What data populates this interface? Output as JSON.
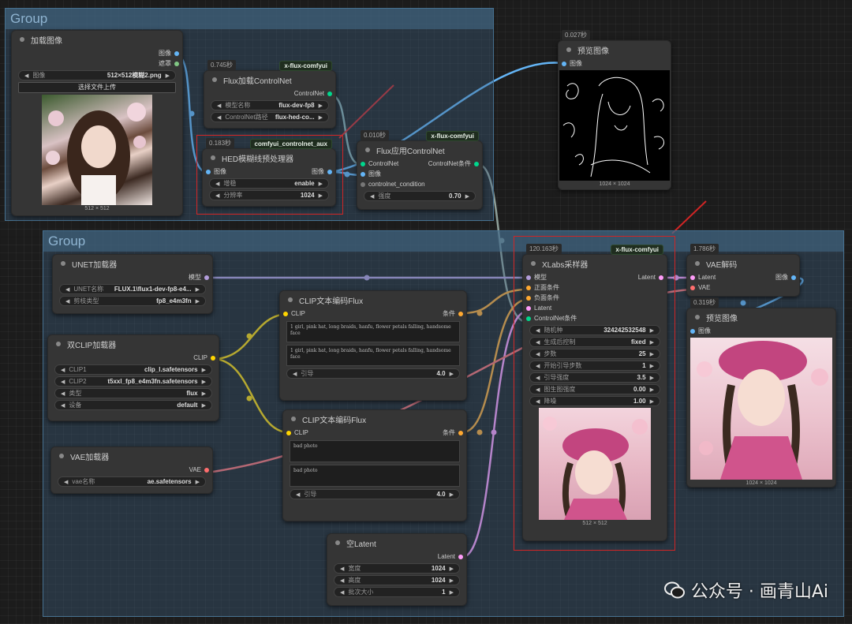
{
  "groups": [
    {
      "title": "Group"
    },
    {
      "title": "Group"
    }
  ],
  "nodes": {
    "load_image": {
      "title": "加载图像",
      "outputs": [
        "图像",
        "遮罩"
      ],
      "image_label": "图像",
      "image_value": "512×512模糊2.png",
      "upload_button": "选择文件上传",
      "caption": "512 × 512"
    },
    "flux_load_cn": {
      "timer": "0.745秒",
      "badge": "x-flux-comfyui",
      "title": "Flux加载ControlNet",
      "output": "ControlNet",
      "model_label": "模型名称",
      "model_value": "flux-dev-fp8",
      "path_label": "ControlNet路径",
      "path_value": "flux-hed-co..."
    },
    "hed": {
      "timer": "0.183秒",
      "badge": "comfyui_controlnet_aux",
      "title": "HED模糊线预处理器",
      "input": "图像",
      "output": "图像",
      "w1_label": "增稳",
      "w1_value": "enable",
      "w2_label": "分辨率",
      "w2_value": "1024"
    },
    "flux_apply_cn": {
      "timer": "0.010秒",
      "badge": "x-flux-comfyui",
      "title": "Flux应用ControlNet",
      "in1": "ControlNet",
      "in2": "图像",
      "in3": "controlnet_condition",
      "output": "ControlNet条件",
      "w_label": "强度",
      "w_value": "0.70"
    },
    "preview1": {
      "timer": "0.027秒",
      "title": "预览图像",
      "input": "图像",
      "caption": "1024 × 1024"
    },
    "unet": {
      "title": "UNET加载器",
      "output": "模型",
      "w1_label": "UNET名称",
      "w1_value": "FLUX.1\\flux1-dev-fp8-e4...",
      "w2_label": "剪枝类型",
      "w2_value": "fp8_e4m3fn"
    },
    "dualclip": {
      "title": "双CLIP加载器",
      "output": "CLIP",
      "w1_label": "CLIP1",
      "w1_value": "clip_l.safetensors",
      "w2_label": "CLIP2",
      "w2_value": "t5xxl_fp8_e4m3fn.safetensors",
      "w3_label": "类型",
      "w3_value": "flux",
      "w4_label": "设备",
      "w4_value": "default"
    },
    "vae_loader": {
      "title": "VAE加载器",
      "output": "VAE",
      "w_label": "vae名称",
      "w_value": "ae.safetensors"
    },
    "clip_pos": {
      "title": "CLIP文本编码Flux",
      "input": "CLIP",
      "output": "条件",
      "text1": "1 girl, pink hat, long braids, hanfu, flower petals falling, handsome face",
      "text2": "1 girl, pink hat, long braids, hanfu, flower petals falling, handsome face",
      "w_label": "引导",
      "w_value": "4.0"
    },
    "clip_neg": {
      "title": "CLIP文本编码Flux",
      "input": "CLIP",
      "output": "条件",
      "text1": "bad photo",
      "text2": "bad photo",
      "w_label": "引导",
      "w_value": "4.0"
    },
    "empty_latent": {
      "title": "空Latent",
      "output": "Latent",
      "w1_label": "宽度",
      "w1_value": "1024",
      "w2_label": "高度",
      "w2_value": "1024",
      "w3_label": "批次大小",
      "w3_value": "1"
    },
    "sampler": {
      "timer": "120.163秒",
      "badge": "x-flux-comfyui",
      "title": "XLabs采样器",
      "in1": "模型",
      "in2": "正面条件",
      "in3": "负面条件",
      "in4": "Latent",
      "in5": "ControlNet条件",
      "output": "Latent",
      "seed_label": "随机种",
      "seed_value": "324242532548",
      "ctrl_label": "生成后控制",
      "ctrl_value": "fixed",
      "steps_label": "步数",
      "steps_value": "25",
      "start_label": "开始引导步数",
      "start_value": "1",
      "guid_label": "引导强度",
      "guid_value": "3.5",
      "i2i_label": "图生图强度",
      "i2i_value": "0.00",
      "denoise_label": "降噪",
      "denoise_value": "1.00",
      "caption": "512 × 512"
    },
    "vae_decode": {
      "timer": "1.786秒",
      "title": "VAE解码",
      "in1": "Latent",
      "in2": "VAE",
      "output": "图像"
    },
    "preview2": {
      "timer": "0.319秒",
      "title": "预览图像",
      "input": "图像",
      "caption": "1024 × 1024"
    }
  },
  "watermark": "公众号 · 画青山Ai",
  "colors": {
    "image": "#64b5f6",
    "mask": "#81c784",
    "model": "#b39ddb",
    "clip": "#ffd500",
    "conditioning": "#ffa931",
    "vae": "#ff6e6e",
    "latent": "#ff9cf9",
    "controlnet": "#00d78d",
    "highlight": "#d02525"
  }
}
